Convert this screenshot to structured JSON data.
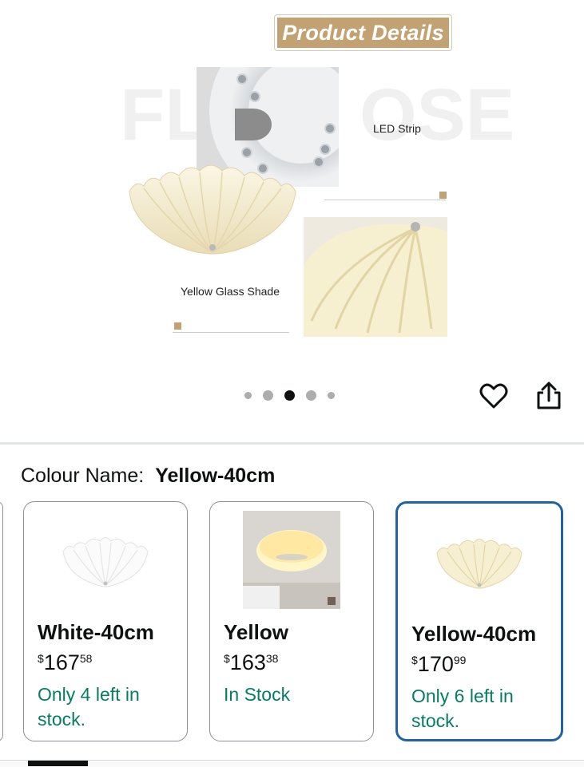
{
  "banner": {
    "title": "Product Details"
  },
  "image": {
    "watermark_left": "FL",
    "watermark_right": "OSE",
    "caption_led": "LED Strip",
    "caption_shade": "Yellow Glass Shade"
  },
  "carousel": {
    "total": 5,
    "active_index": 2
  },
  "icons": {
    "favorite": "heart-icon",
    "share": "share-icon"
  },
  "colour": {
    "label": "Colour Name:",
    "value": "Yellow-40cm"
  },
  "variants": [
    {
      "name": "White-40cm",
      "currency": "$",
      "price_whole": "167",
      "price_fraction": "58",
      "stock": "Only 4 left in stock.",
      "selected": false
    },
    {
      "name": "Yellow",
      "currency": "$",
      "price_whole": "163",
      "price_fraction": "38",
      "stock": "In Stock",
      "selected": false
    },
    {
      "name": "Yellow-40cm",
      "currency": "$",
      "price_whole": "170",
      "price_fraction": "99",
      "stock": "Only 6 left in stock.",
      "selected": true
    }
  ],
  "colors": {
    "accent_gold": "#c2a273",
    "selected_border": "#2162a1",
    "stock_green": "#067d62"
  }
}
